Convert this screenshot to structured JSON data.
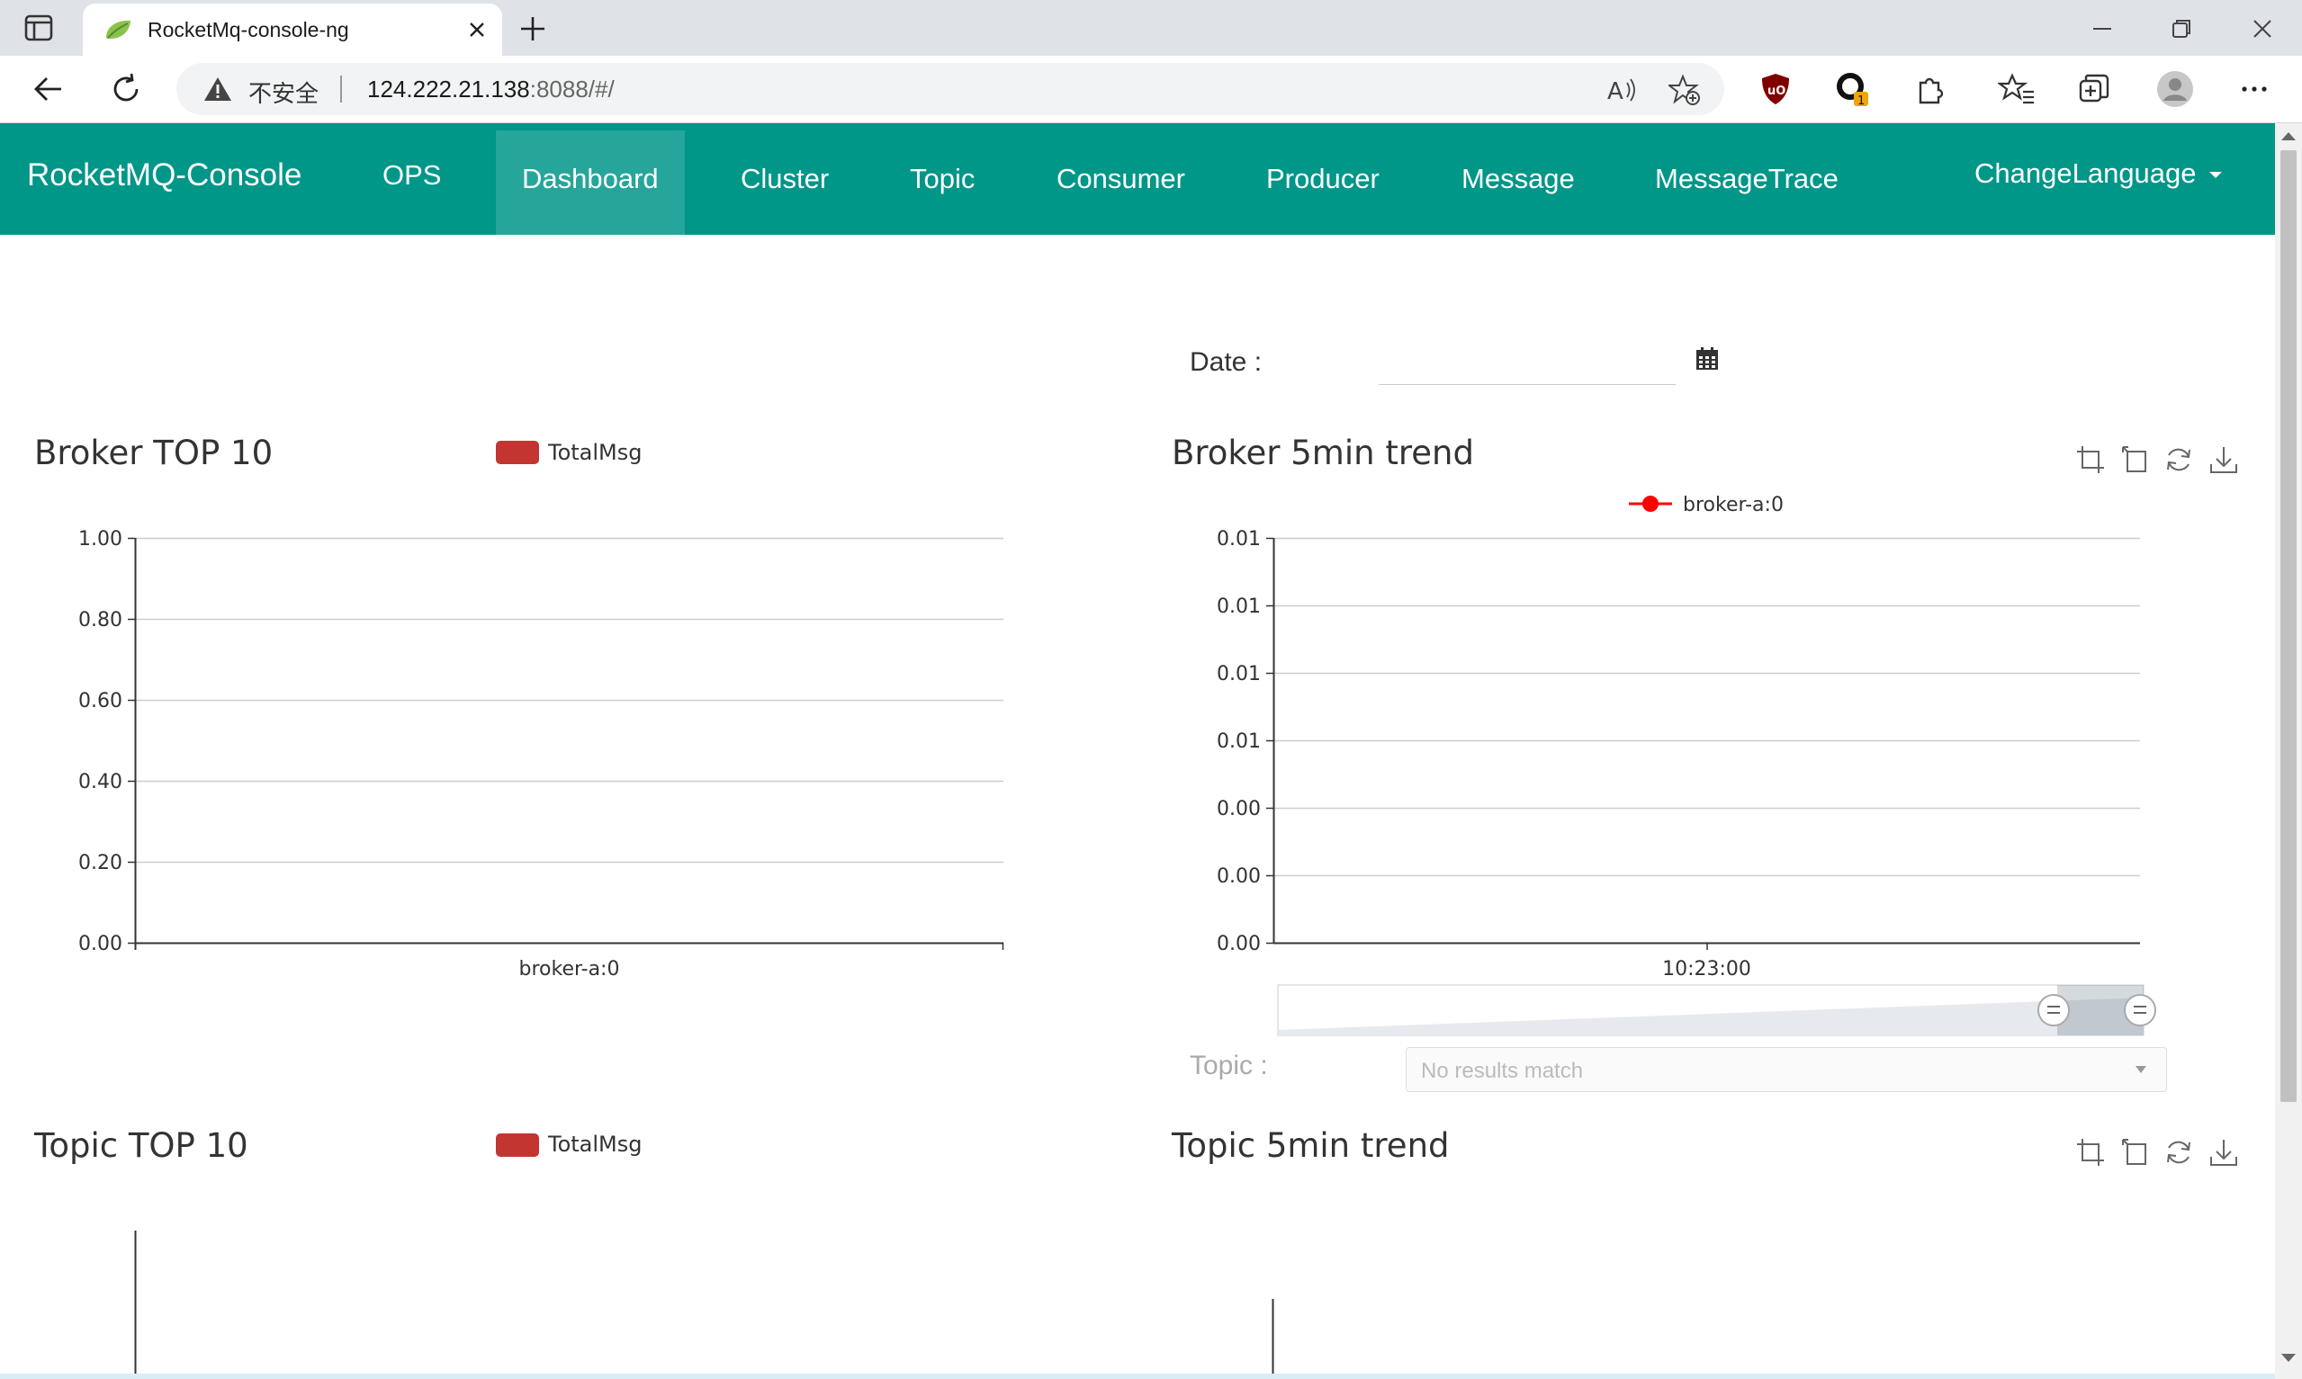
{
  "browser": {
    "tab_title": "RocketMq-console-ng",
    "security_text": "不安全",
    "url_host": "124.222.21.138",
    "url_rest": ":8088/#/",
    "extension_badge": "1"
  },
  "app": {
    "brand": "RocketMQ-Console",
    "nav": {
      "ops": "OPS",
      "dashboard": "Dashboard",
      "cluster": "Cluster",
      "topic": "Topic",
      "consumer": "Consumer",
      "producer": "Producer",
      "message": "Message",
      "message_trace": "MessageTrace",
      "change_language": "ChangeLanguage"
    },
    "active_nav": "Dashboard",
    "accent_color": "#009688"
  },
  "dashboard": {
    "date_label": "Date :",
    "date_value": "",
    "topic_label": "Topic :",
    "topic_placeholder": "No results match",
    "broker_top": {
      "title": "Broker TOP 10",
      "legend": "TotalMsg"
    },
    "broker_trend": {
      "title": "Broker 5min trend",
      "legend": "broker-a:0"
    },
    "topic_top": {
      "title": "Topic TOP 10",
      "legend": "TotalMsg"
    },
    "topic_trend": {
      "title": "Topic 5min trend"
    }
  },
  "chart_data": [
    {
      "type": "bar",
      "title": "Broker TOP 10",
      "categories": [
        "broker-a:0"
      ],
      "series": [
        {
          "name": "TotalMsg",
          "values": [
            0
          ]
        }
      ],
      "y_ticks": [
        "0.00",
        "0.20",
        "0.40",
        "0.60",
        "0.80",
        "1.00"
      ],
      "ylim": [
        0,
        1
      ],
      "grid": true,
      "legend_position": "top",
      "color": "#c23531"
    },
    {
      "type": "line",
      "title": "Broker 5min trend",
      "x": [
        "10:23:00"
      ],
      "series": [
        {
          "name": "broker-a:0",
          "values": [
            0
          ]
        }
      ],
      "y_ticks": [
        "0.00",
        "0.00",
        "0.00",
        "0.01",
        "0.01",
        "0.01",
        "0.01"
      ],
      "grid": true,
      "legend_position": "top",
      "data_zoom": true,
      "color": "#ff0000"
    }
  ]
}
